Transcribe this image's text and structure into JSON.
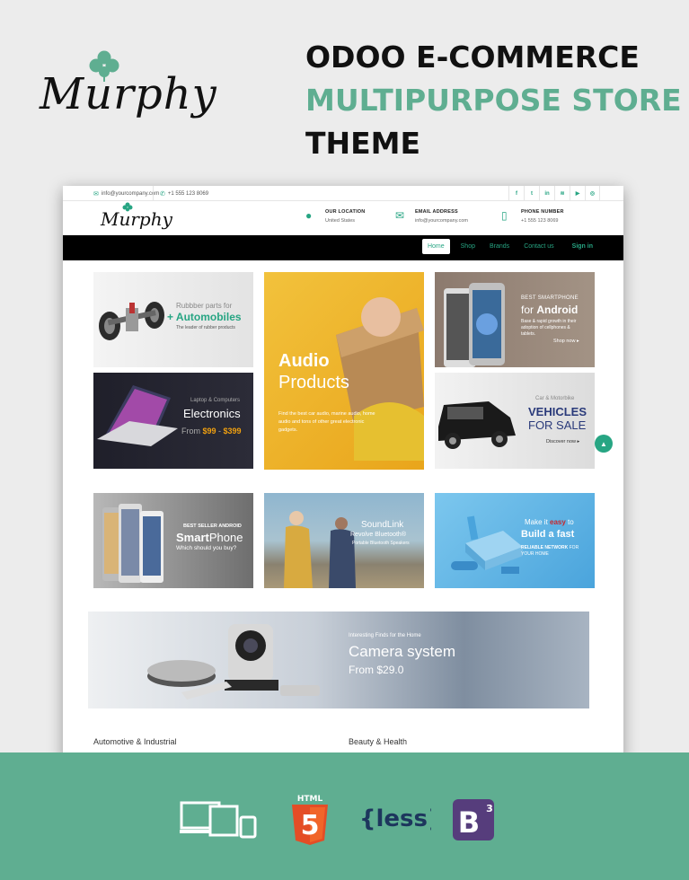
{
  "hero": {
    "logo_text": "Murphy",
    "headline_1": "ODOO E-COMMERCE",
    "headline_2": "MULTIPURPOSE STORE",
    "headline_3": "THEME"
  },
  "topstrip": {
    "email": "info@yourcompany.com",
    "phone": "+1 555 123 8069",
    "social_icons": [
      "facebook-icon",
      "twitter-icon",
      "linkedin-icon",
      "rss-icon",
      "youtube-icon",
      "instagram-icon"
    ]
  },
  "header": {
    "logo_text": "Murphy",
    "location_title": "OUR LOCATION",
    "location_value": "United States",
    "email_title": "EMAIL ADDRESS",
    "email_value": "info@yourcompany.com",
    "phone_title": "PHONE NUMBER",
    "phone_value": "+1 555 123 8069"
  },
  "nav": {
    "items": [
      "Home",
      "Shop",
      "Brands",
      "Contact us"
    ],
    "signin": "Sign in"
  },
  "banners": {
    "automobiles": {
      "line1": "Rubbber parts for",
      "line2": "+ Automobiles",
      "line3": "The leader of rubber products"
    },
    "audio": {
      "line1": "Audio",
      "line2": "Products",
      "line3": "Find the best car audio, marine audio, home audio and tons of other great electronic gadgets."
    },
    "android": {
      "line1": "BEST SMARTPHONE",
      "line2a": "for ",
      "line2b": "Android",
      "line3": "Base & rapid growth in their adoption of cellphones & tablets.",
      "cta": "Shop now"
    },
    "electronics": {
      "line1": "Laptop & Computers",
      "line2": "Electronics",
      "line3a": "From ",
      "line3b": "$99",
      "line3c": " - ",
      "line3d": "$399"
    },
    "vehicles": {
      "line1": "Car & Motorbike",
      "line2": "VEHICLES",
      "line3": "FOR SALE",
      "cta": "Discover now"
    },
    "smartphone": {
      "line1": "BEST SELLER ANDROID",
      "line2a": "Smart",
      "line2b": "Phone",
      "line3": "Which should you buy?"
    },
    "soundlink": {
      "line1": "SoundLink",
      "line2": "Revolve Bluetooth®",
      "line3": "Portable Bluetooth Speakers"
    },
    "network": {
      "line1a": "Make it ",
      "line1b": "easy",
      "line1c": " to",
      "line2": "Build a fast",
      "line3": "RELIABLE NETWORK",
      "line3b": " FOR YOUR HOME"
    },
    "camera": {
      "line1": "Interesting Finds for the Home",
      "line2": "Camera system",
      "line3": "From ",
      "line3b": "$29.0"
    }
  },
  "categories": {
    "left": "Automotive & Industrial",
    "right": "Beauty & Health"
  },
  "tech_icons": [
    "devices-icon",
    "html5-icon",
    "less-icon",
    "bootstrap-icon"
  ],
  "tech_text": {
    "html": "HTML",
    "html_num": "5",
    "less": "{less}",
    "bootstrap": "B",
    "bootstrap_sup": "3"
  },
  "colors": {
    "accent": "#5fae91",
    "nav_accent": "#27a583",
    "nav_bg": "#000000"
  }
}
